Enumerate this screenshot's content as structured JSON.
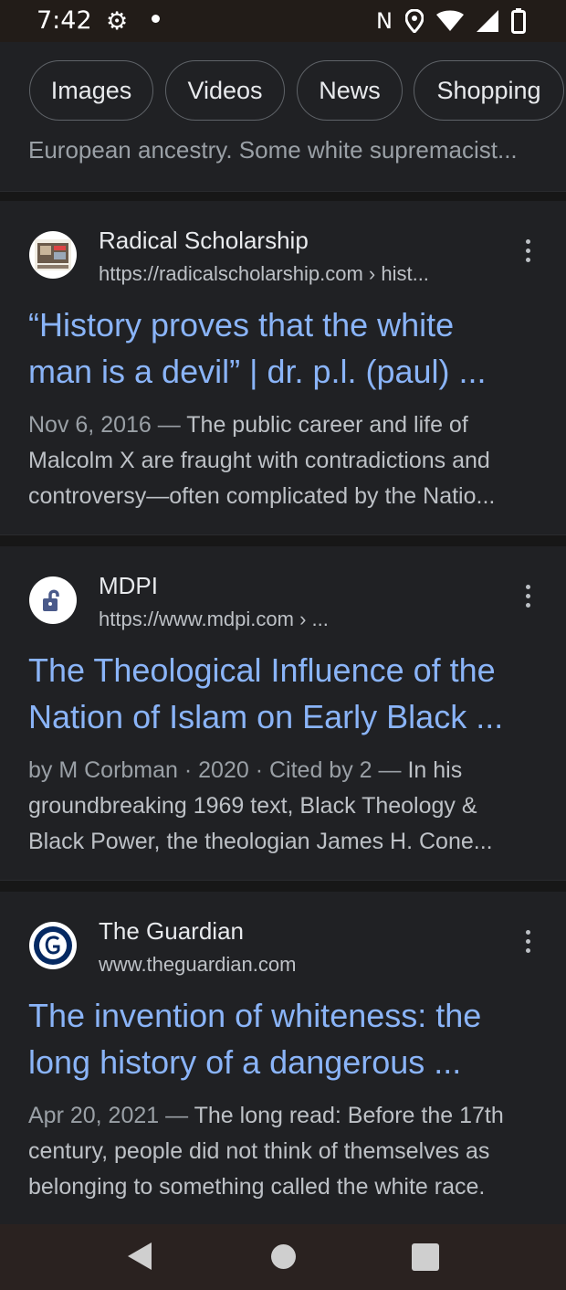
{
  "status_bar": {
    "time": "7:42",
    "icons": [
      "gear-icon",
      "dot-icon",
      "nfc-icon",
      "location-icon",
      "wifi-icon",
      "signal-icon",
      "battery-icon"
    ],
    "nfc_label": "N"
  },
  "chips": [
    {
      "label": "Images"
    },
    {
      "label": "Videos"
    },
    {
      "label": "News"
    },
    {
      "label": "Shopping"
    }
  ],
  "previous_snippet": "European ancestry. Some white supremacist...",
  "results": [
    {
      "site_name": "Radical Scholarship",
      "url": "https://radicalscholarship.com › hist...",
      "title_line1": "“History proves that the white",
      "title_line2": "man is a devil” | dr. p.l. (paul) ...",
      "meta": "Nov 6, 2016 — ",
      "snippet_line1": "The public career and life of",
      "snippet_line2": "Malcolm X are fraught with contradictions and",
      "snippet_line3": "controversy—often complicated by the Natio..."
    },
    {
      "site_name": "MDPI",
      "url": "https://www.mdpi.com › ...",
      "title_line1": "The Theological Influence of the",
      "title_line2": "Nation of Islam on Early Black ...",
      "meta": "by M Corbman · 2020 · Cited by 2 — ",
      "snippet_line1": "In his",
      "snippet_line2": "groundbreaking 1969 text, Black Theology &",
      "snippet_line3": "Black Power, the theologian James H. Cone..."
    },
    {
      "site_name": "The Guardian",
      "url": "www.theguardian.com",
      "title_line1": "The invention of whiteness: the",
      "title_line2": "long history of a dangerous ...",
      "meta": "Apr 20, 2021 — ",
      "snippet_line1": "The long read: Before the 17th",
      "snippet_line2": "century, people did not think of themselves as",
      "snippet_line3": "belonging to something called the white race."
    }
  ],
  "colors": {
    "background": "#202124",
    "link": "#8ab4f8",
    "text": "#e8eaed",
    "muted": "#9aa0a6"
  }
}
